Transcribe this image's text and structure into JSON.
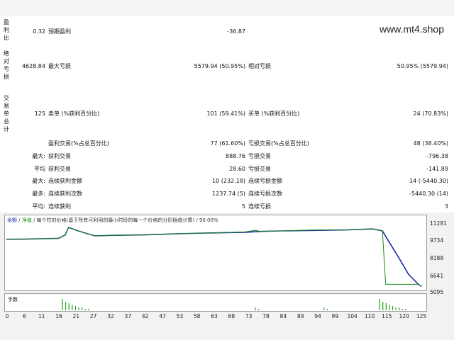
{
  "brand": "www.mt4.shop",
  "vertical_labels": {
    "profit_ratio": [
      "盈",
      "利",
      "比"
    ],
    "absolute_drawdown": [
      "绝",
      "对",
      "亏",
      "损"
    ],
    "total_trades": [
      "交",
      "易",
      "单",
      "总",
      "计"
    ]
  },
  "rows": [
    {
      "c1": "0.32",
      "c2": "预期盈利",
      "c3": "-36.87"
    },
    {
      "c1": "4628.84",
      "c2": "最大亏损",
      "c3": "5579.94 (50.95%)",
      "c4": "相对亏损",
      "c5": "50.95% (5579.94)"
    },
    {
      "c1": "125",
      "c2": "卖单 (%获利百分比)",
      "c3": "101 (59.41%)",
      "c4": "买单 (%获利百分比)",
      "c5": "24 (70.83%)"
    }
  ],
  "stats": [
    {
      "pre": "",
      "k1": "盈利交易(%占总百分比)",
      "v1": "77 (61.60%)",
      "k2": "亏损交易(%占总百分比)",
      "v2": "48 (38.40%)"
    },
    {
      "pre": "最大:",
      "k1": "获利交易",
      "v1": "888.76",
      "k2": "亏损交易",
      "v2": "-796.38"
    },
    {
      "pre": "平均",
      "k1": "获利交易",
      "v1": "28.60",
      "k2": "亏损交易",
      "v2": "-141.89"
    },
    {
      "pre": "最大:",
      "k1": "连续获利金额",
      "v1": "10 (232.18)",
      "k2": "连续亏损金额",
      "v2": "14 (-5440.30)"
    },
    {
      "pre": "最多:",
      "k1": "连续获利次数",
      "v1": "1237.74 (5)",
      "k2": "连续亏损次数",
      "v2": "-5440.30 (14)"
    },
    {
      "pre": "平均:",
      "k1": "连续获利",
      "v1": "5",
      "k2": "连续亏损",
      "v2": "3"
    }
  ],
  "legend": {
    "balance": "余额",
    "sep1": " / ",
    "equity": "净值",
    "rest": " / 每个柱的价格(基于所有可利用的最小时段的每一个价格的分形插值计算) / 90.00%"
  },
  "volume_label": "手数",
  "colors": {
    "balance": "#1a2aa6",
    "equity": "#1b8a1b",
    "volume": "#22a022"
  },
  "chart_data": {
    "type": "line",
    "x_ticks": [
      "0",
      "6",
      "11",
      "16",
      "21",
      "27",
      "32",
      "37",
      "42",
      "47",
      "53",
      "58",
      "63",
      "68",
      "73",
      "78",
      "84",
      "89",
      "94",
      "99",
      "104",
      "110",
      "115",
      "120",
      "125"
    ],
    "y_ticks": [
      "11281",
      "9734",
      "8188",
      "6641",
      "5095"
    ],
    "xlim": [
      0,
      128
    ],
    "ylim": [
      4900,
      11700
    ],
    "series": [
      {
        "key": "balance",
        "points": [
          [
            0,
            9850
          ],
          [
            6,
            9870
          ],
          [
            16,
            9950
          ],
          [
            18,
            10300
          ],
          [
            19,
            11050
          ],
          [
            22,
            10700
          ],
          [
            27,
            10200
          ],
          [
            32,
            10250
          ],
          [
            42,
            10300
          ],
          [
            53,
            10420
          ],
          [
            63,
            10500
          ],
          [
            73,
            10560
          ],
          [
            78,
            10650
          ],
          [
            84,
            10700
          ],
          [
            94,
            10750
          ],
          [
            104,
            10800
          ],
          [
            112,
            10900
          ],
          [
            115,
            10700
          ],
          [
            117,
            9600
          ],
          [
            120,
            8000
          ],
          [
            123,
            6300
          ],
          [
            126,
            5300
          ],
          [
            127,
            5095
          ]
        ]
      },
      {
        "key": "equity",
        "points": [
          [
            0,
            9850
          ],
          [
            6,
            9870
          ],
          [
            16,
            9950
          ],
          [
            18,
            10300
          ],
          [
            19,
            11050
          ],
          [
            22,
            10700
          ],
          [
            27,
            10200
          ],
          [
            32,
            10250
          ],
          [
            42,
            10300
          ],
          [
            53,
            10420
          ],
          [
            63,
            10500
          ],
          [
            73,
            10600
          ],
          [
            76,
            10750
          ],
          [
            78,
            10650
          ],
          [
            84,
            10700
          ],
          [
            94,
            10800
          ],
          [
            104,
            10800
          ],
          [
            112,
            10900
          ],
          [
            115,
            10700
          ],
          [
            116,
            5300
          ],
          [
            126,
            5300
          ],
          [
            127,
            5095
          ]
        ]
      }
    ],
    "volume": [
      [
        17,
        8
      ],
      [
        18,
        6
      ],
      [
        19,
        5
      ],
      [
        20,
        4
      ],
      [
        21,
        3
      ],
      [
        22,
        2
      ],
      [
        23,
        2
      ],
      [
        24,
        1
      ],
      [
        25,
        1
      ],
      [
        76,
        2
      ],
      [
        77,
        1
      ],
      [
        97,
        2
      ],
      [
        98,
        1
      ],
      [
        114,
        8
      ],
      [
        115,
        6
      ],
      [
        116,
        5
      ],
      [
        117,
        4
      ],
      [
        118,
        3
      ],
      [
        119,
        2
      ],
      [
        120,
        2
      ],
      [
        121,
        1
      ],
      [
        122,
        1
      ]
    ]
  }
}
